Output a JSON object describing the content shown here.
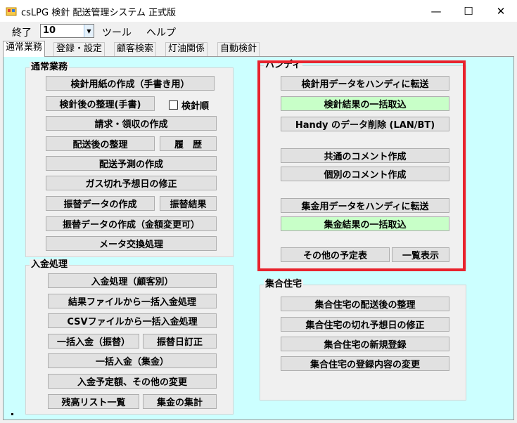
{
  "window": {
    "title": "csLPG 検針 配送管理システム 正式版",
    "minimize": "—",
    "maximize": "☐",
    "close": "✕"
  },
  "menu": {
    "exit": "終了",
    "combo_value": "10",
    "tools": "ツール",
    "help": "ヘルプ"
  },
  "tabs": [
    "通常業務",
    "登録・設定",
    "顧客検索",
    "灯油関係",
    "自動検針"
  ],
  "groups": {
    "normal": {
      "title": "通常業務",
      "create_form": "検針用紙の作成（手書き用）",
      "after_reading": "検針後の整理(手書)",
      "reading_order": "検針順",
      "billing": "請求・領収の作成",
      "after_delivery": "配送後の整理",
      "history": "履　歴",
      "delivery_forecast": "配送予測の作成",
      "gas_out_fix": "ガス切れ予想日の修正",
      "transfer_create": "振替データの作成",
      "transfer_result": "振替結果",
      "transfer_create_amount": "振替データの作成（金額変更可）",
      "meter_exchange": "メータ交換処理"
    },
    "payment": {
      "title": "入金処理",
      "by_customer": "入金処理（顧客別）",
      "from_result_file": "結果ファイルから一括入金処理",
      "from_csv": "CSVファイルから一括入金処理",
      "bulk_transfer": "一括入金（振替）",
      "transfer_date_fix": "振替日訂正",
      "bulk_collection": "一括入金（集金）",
      "scheduled_change": "入金予定額、その他の変更",
      "balance_list": "残高リスト一覧",
      "collection_total": "集金の集計"
    },
    "handy": {
      "title": "ハンディ",
      "transfer_reading": "検針用データをハンディに転送",
      "import_results": "検針結果の一括取込",
      "delete_data": "Handy のデータ削除 (LAN/BT)",
      "common_comment": "共通のコメント作成",
      "individual_comment": "個別のコメント作成",
      "transfer_collection": "集金用データをハンディに転送",
      "import_collection": "集金結果の一括取込",
      "other_schedule": "その他の予定表",
      "list_view": "一覧表示"
    },
    "complex": {
      "title": "集合住宅",
      "after_delivery": "集合住宅の配送後の整理",
      "gas_out_fix": "集合住宅の切れ予想日の修正",
      "new_register": "集合住宅の新規登録",
      "edit_register": "集合住宅の登録内容の変更"
    }
  }
}
